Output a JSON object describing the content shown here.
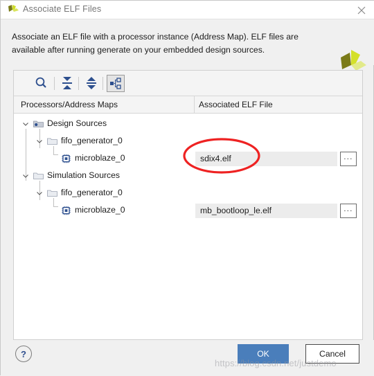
{
  "window": {
    "title": "Associate ELF Files",
    "logo_icon": "xilinx-logo-icon",
    "close_icon": "close-icon"
  },
  "header": {
    "description": "Associate an ELF file with a processor instance (Address Map). ELF files are available after running generate on your embedded design sources.",
    "logo_icon": "xilinx-logo-icon"
  },
  "toolbar": {
    "buttons": [
      {
        "name": "search-icon",
        "tooltip": "Search"
      },
      {
        "name": "collapse-all-icon",
        "tooltip": "Collapse All"
      },
      {
        "name": "expand-all-icon",
        "tooltip": "Expand All"
      },
      {
        "name": "hierarchy-icon",
        "tooltip": "Show Hierarchy",
        "selected": true
      }
    ]
  },
  "table": {
    "columns": [
      {
        "label": "Processors/Address Maps"
      },
      {
        "label": "Associated ELF File"
      }
    ],
    "rows": [
      {
        "label": "Design Sources",
        "depth": 0,
        "icon": "folder-design-sources-icon",
        "expanded": true,
        "elf": null
      },
      {
        "label": "fifo_generator_0",
        "depth": 1,
        "icon": "folder-icon",
        "expanded": true,
        "elf": null
      },
      {
        "label": "microblaze_0",
        "depth": 2,
        "icon": "processor-chip-icon",
        "expanded": false,
        "elf": "sdix4.elf",
        "browse_label": "..."
      },
      {
        "label": "Simulation Sources",
        "depth": 0,
        "icon": "folder-icon",
        "expanded": true,
        "elf": null
      },
      {
        "label": "fifo_generator_0",
        "depth": 1,
        "icon": "folder-icon",
        "expanded": true,
        "elf": null
      },
      {
        "label": "microblaze_0",
        "depth": 2,
        "icon": "processor-chip-icon",
        "expanded": false,
        "elf": "mb_bootloop_le.elf",
        "browse_label": "..."
      }
    ]
  },
  "footer": {
    "help_label": "?",
    "ok_label": "OK",
    "cancel_label": "Cancel"
  },
  "annotation": {
    "type": "red-ellipse",
    "target": "sdix4.elf",
    "color": "#ee2222"
  },
  "watermark": {
    "text": "https://blog.csdn.net/justdemo"
  },
  "colors": {
    "accent": "#4a7ebb",
    "icon_blue": "#2d4f8e",
    "logo_dark": "#7a7a18",
    "logo_bright": "#d4e02a",
    "logo_light": "#e2ea8a",
    "annotation_red": "#ee2222"
  }
}
